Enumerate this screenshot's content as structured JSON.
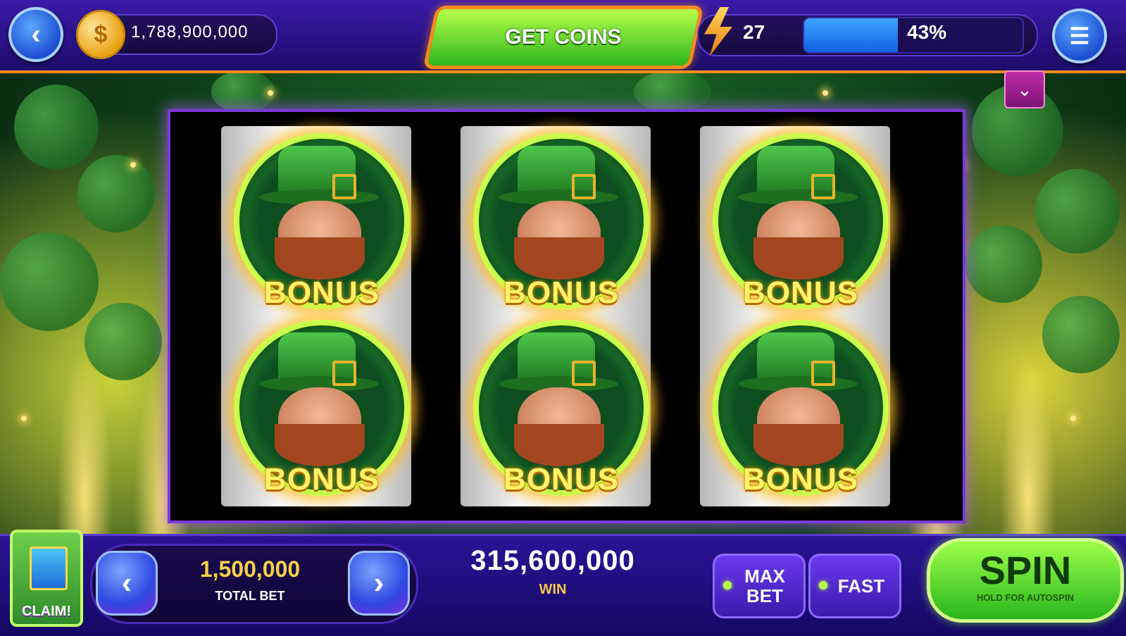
{
  "top_bar": {
    "coin_balance": "1,788,900,000",
    "get_coins_label": "GET COINS",
    "level": "27",
    "xp_progress_percent": 43,
    "xp_text": "43%"
  },
  "reels": [
    {
      "symbols": [
        {
          "label": "BONUS"
        },
        {
          "label": "BONUS"
        }
      ]
    },
    {
      "symbols": [
        {
          "label": "BONUS"
        },
        {
          "label": "BONUS"
        }
      ]
    },
    {
      "symbols": [
        {
          "label": "BONUS"
        },
        {
          "label": "BONUS"
        }
      ]
    }
  ],
  "bottom_bar": {
    "claim_label": "CLAIM!",
    "total_bet_value": "1,500,000",
    "total_bet_label": "TOTAL BET",
    "win_value": "315,600,000",
    "win_label": "WIN",
    "max_bet_label": "MAX BET",
    "fast_label": "FAST",
    "spin_label": "SPIN",
    "spin_sublabel": "HOLD FOR AUTOSPIN"
  },
  "colors": {
    "accent_orange": "#f28a1c",
    "spin_green": "#29b51c",
    "bonus_yellow": "#fff36a"
  },
  "icons": {
    "back": "chevron-left-icon",
    "menu": "hamburger-menu-icon",
    "coin": "coin-icon",
    "level": "lightning-bolt-icon",
    "dropdown": "chevron-down-icon",
    "gift": "gift-icon"
  }
}
